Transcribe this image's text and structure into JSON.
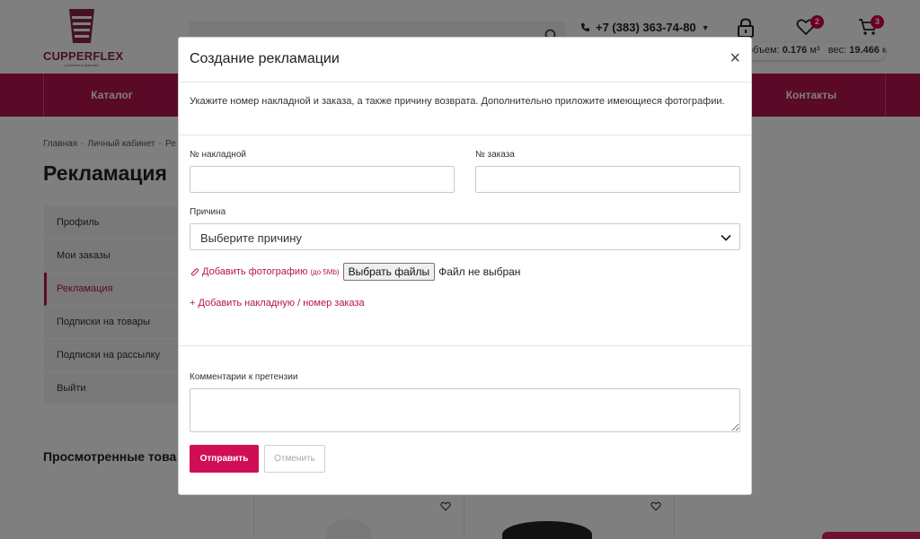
{
  "header": {
    "logo_text": "CUPPERFLEX",
    "logo_subtitle": "решения в упаковке",
    "phone": "+7 (383) 363-74-80",
    "favorites_count": "2",
    "cart_count": "3",
    "totals_volume_label": "объем:",
    "totals_volume_value": "0.176",
    "totals_volume_unit": "м³",
    "totals_weight_label": "вес:",
    "totals_weight_value": "19.466",
    "totals_weight_unit": "кг"
  },
  "nav": {
    "catalog": "Каталог",
    "contacts": "Контакты"
  },
  "breadcrumb": {
    "home": "Главная",
    "cabinet": "Личный кабинет",
    "current": "Ре"
  },
  "page_title": "Рекламация",
  "sidebar": {
    "items": [
      {
        "label": "Профиль"
      },
      {
        "label": "Мои заказы"
      },
      {
        "label": "Рекламация"
      },
      {
        "label": "Подписки на товары"
      },
      {
        "label": "Подписки на рассылку"
      },
      {
        "label": "Выйти"
      }
    ]
  },
  "viewed_title": "Просмотренные това",
  "modal": {
    "title": "Создание рекламации",
    "close": "×",
    "intro": "Укажите номер накладной и заказа, а также причину возврата. Дополнительно приложите имеющиеся фотографии.",
    "invoice_label": "№ накладной",
    "order_label": "№ заказа",
    "reason_label": "Причина",
    "reason_placeholder": "Выберите причину",
    "add_photo": "Добавить фотографию",
    "photo_limit": "(до 5Mb)",
    "file_button": "Выбрать файлы",
    "file_status": "Файл не выбран",
    "add_invoice_link": "+ Добавить накладную / номер заказа",
    "comment_label": "Комментарии к претензии",
    "send_button": "Отправить",
    "cancel_button": "Отменить"
  },
  "colors": {
    "brand": "#b5124f",
    "primary_button": "#d10e55",
    "badge": "#d6003e"
  }
}
